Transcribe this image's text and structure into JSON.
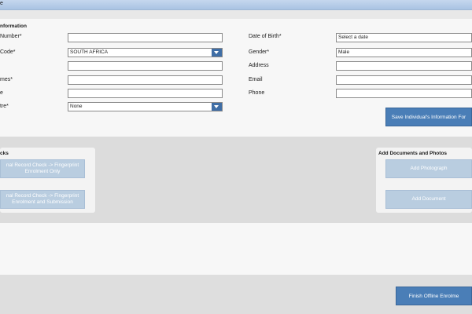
{
  "window": {
    "title": "e"
  },
  "individual": {
    "section_title": "nformation",
    "left_fields": [
      {
        "label": "Number*",
        "value": ""
      },
      {
        "label": "Code*",
        "value": "SOUTH AFRICA"
      },
      {
        "label": "",
        "value": ""
      },
      {
        "label": "mes*",
        "value": ""
      },
      {
        "label": "e",
        "value": ""
      },
      {
        "label": "tre*",
        "value": "None"
      }
    ],
    "right_fields": [
      {
        "label": "Date of Birth*",
        "value": "Select a date"
      },
      {
        "label": "Gender*",
        "value": "Male"
      },
      {
        "label": "Address",
        "value": ""
      },
      {
        "label": "Email",
        "value": ""
      },
      {
        "label": "Phone",
        "value": ""
      }
    ],
    "save_button": "Save Individual's Information For"
  },
  "checks": {
    "title": "cks",
    "buttons": [
      {
        "label": "nal Record Check -> Fingerprint Enrolment Only"
      },
      {
        "label": "nal Record Check -> Fingerprint Enrolment and Submission"
      }
    ]
  },
  "documents": {
    "title": "Add Documents and Photos",
    "add_photo": "Add Photograph",
    "add_document": "Add Document"
  },
  "footer": {
    "finish_button": "Finish Offline Enrolme"
  },
  "colors": {
    "accent": "#4a7eb7",
    "disabled": "#b9cde0",
    "combo": "#3f6ea6"
  }
}
